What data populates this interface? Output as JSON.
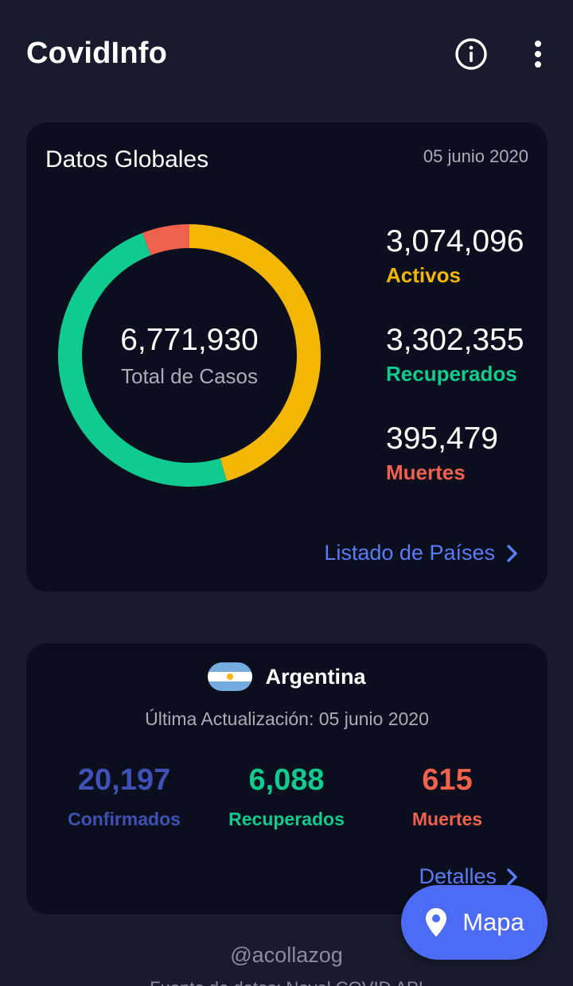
{
  "app": {
    "title": "CovidInfo",
    "icons": {
      "info": "info-circle-icon",
      "menu": "more-vert-icon"
    }
  },
  "global": {
    "title": "Datos Globales",
    "date": "05 junio 2020",
    "total_value": "6,771,930",
    "total_label": "Total de Casos",
    "stats": [
      {
        "value": "3,074,096",
        "label": "Activos",
        "color": "#f2b705"
      },
      {
        "value": "3,302,355",
        "label": "Recuperados",
        "color": "#0fcb8f"
      },
      {
        "value": "395,479",
        "label": "Muertes",
        "color": "#f0624e"
      }
    ],
    "link_label": "Listado de Países"
  },
  "country": {
    "name": "Argentina",
    "updated": "Última Actualización: 05 junio 2020",
    "stats": [
      {
        "value": "20,197",
        "label": "Confirmados",
        "color": "#3f51b5"
      },
      {
        "value": "6,088",
        "label": "Recuperados",
        "color": "#0fcb8f"
      },
      {
        "value": "615",
        "label": "Muertes",
        "color": "#f0624e"
      }
    ],
    "link_label": "Detalles"
  },
  "fab": {
    "label": "Mapa",
    "icon": "map-pin-icon"
  },
  "footer": {
    "handle": "@acollazog",
    "source": "Fuente de datos: Novel COVID API"
  },
  "chart_data": {
    "type": "pie",
    "title": "",
    "categories": [
      "Activos",
      "Recuperados",
      "Muertes"
    ],
    "values": [
      3074096,
      3302355,
      395479
    ],
    "colors": [
      "#f2b705",
      "#0fcb8f",
      "#f0624e"
    ],
    "total": 6771930
  }
}
